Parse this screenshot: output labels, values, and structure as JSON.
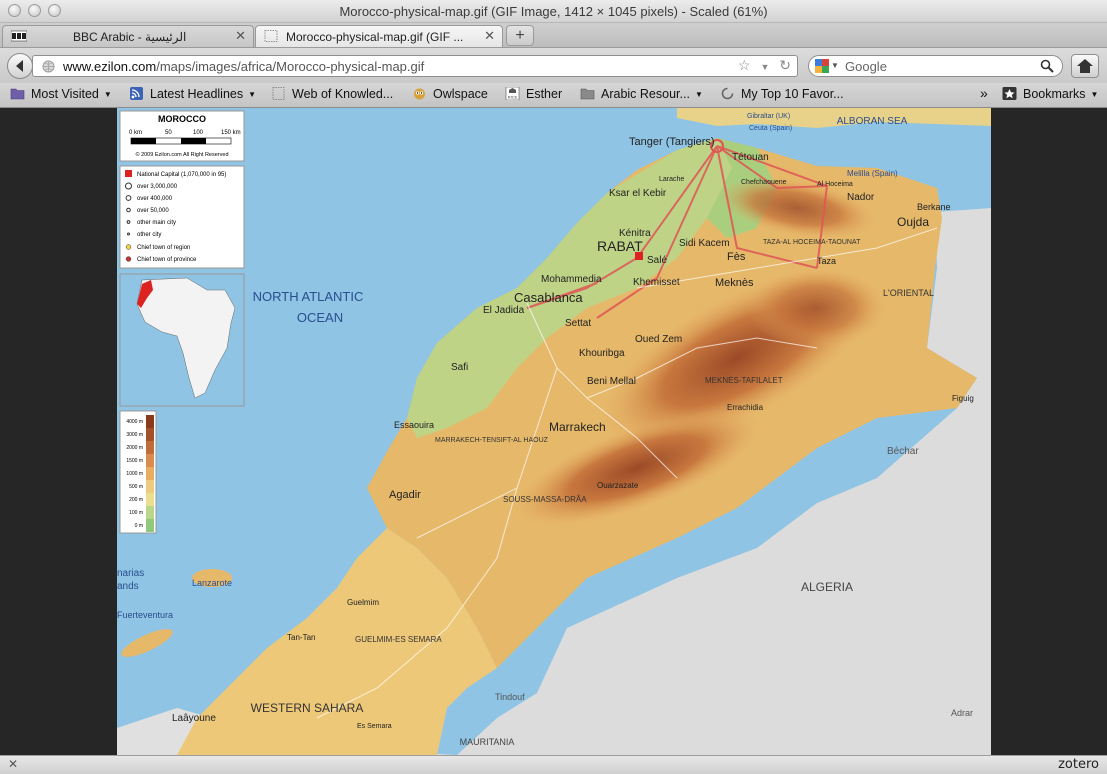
{
  "window": {
    "title": "Morocco-physical-map.gif (GIF Image, 1412 × 1045 pixels) - Scaled (61%)"
  },
  "tabs": [
    {
      "label": "BBC Arabic - الرئيسية",
      "favicon": "bbc-icon",
      "active": false
    },
    {
      "label": "Morocco-physical-map.gif (GIF ...",
      "favicon": "image-icon",
      "active": true
    }
  ],
  "toolbar": {
    "url_domain": "www.ezilon.com",
    "url_path": "/maps/images/africa/Morocco-physical-map.gif",
    "search_placeholder": "Google"
  },
  "bookmarks": [
    {
      "label": "Most Visited",
      "icon": "folder-icon",
      "dropdown": true
    },
    {
      "label": "Latest Headlines",
      "icon": "rss-icon",
      "dropdown": true
    },
    {
      "label": "Web of Knowled...",
      "icon": "page-icon",
      "dropdown": false
    },
    {
      "label": "Owlspace",
      "icon": "owl-icon",
      "dropdown": false
    },
    {
      "label": "Esther",
      "icon": "esther-icon",
      "dropdown": false
    },
    {
      "label": "Arabic Resour...",
      "icon": "folder-icon",
      "dropdown": true
    },
    {
      "label": "My Top 10 Favor...",
      "icon": "loading-icon",
      "dropdown": false
    }
  ],
  "bookmarks_menu": {
    "label": "Bookmarks",
    "chevron": "»"
  },
  "status": {
    "close_glyph": "✕",
    "zotero": "zotero"
  },
  "map": {
    "legend_title": "MOROCCO",
    "scale_ticks": [
      "0 km",
      "50",
      "100",
      "150 km"
    ],
    "copyright": "© 2009 Ezilon.com All Right Reserved",
    "legend_items": [
      "National Capital (1,070,000 in 95)",
      "over 3,000,000",
      "over 400,000",
      "over 50,000",
      "other main city",
      "other city",
      "Chief town of region",
      "Chief town of province"
    ],
    "elevation_labels": [
      "4000 m",
      "3000 m",
      "2000 m",
      "1500 m",
      "1000 m",
      "500 m",
      "200 m",
      "100 m",
      "0 m"
    ],
    "elevation_colors": [
      "#8a3b1c",
      "#a4512a",
      "#c26c3b",
      "#d98c4d",
      "#e8ad63",
      "#efcb80",
      "#e9df8f",
      "#b9d68a",
      "#8fc97b"
    ],
    "ocean_label_1": "NORTH ATLANTIC",
    "ocean_label_2": "OCEAN",
    "sea_label": "ALBORAN SEA",
    "country_algeria": "ALGERIA",
    "western_sahara": "WESTERN SAHARA",
    "mauritania": "MAURITANIA",
    "canarias": "narias",
    "canarias_sub": "ands",
    "lanzarote": "Lanzarote",
    "fuerteventura": "Fuerteventura",
    "cities": {
      "tanger": "Tanger (Tangiers)",
      "tetouan": "Tétouan",
      "ceuta": "Ceuta (Spain)",
      "gibraltar": "Gibraltar (UK)",
      "melilla": "Melilla (Spain)",
      "nador": "Nador",
      "oujda": "Oujda",
      "berkane": "Berkane",
      "ksar": "Ksar el Kebir",
      "kenitra": "Kénitra",
      "rabat": "RABAT",
      "sale": "Salé",
      "sidikacem": "Sidi Kacem",
      "fes": "Fès",
      "meknes": "Meknès",
      "taza": "Taza",
      "mohammedia": "Mohammedia",
      "casablanca": "Casablanca",
      "khemisset": "Khemisset",
      "eljadida": "El Jadida",
      "settat": "Settat",
      "ouedzem": "Oued Zem",
      "khouribga": "Khouribga",
      "safi": "Safi",
      "benimellal": "Beni Mellal",
      "essaouira": "Essaouira",
      "marrakech": "Marrakech",
      "agadir": "Agadir",
      "ouarzazate": "Ouarzazate",
      "guelmim": "Guelmim",
      "tantan": "Tan-Tan",
      "laayoune": "Laâyoune",
      "smara": "Es Semara",
      "bechar": "Béchar",
      "figuig": "Figuig",
      "errachidia": "Errachidia",
      "tindouf": "Tindouf",
      "adrar": "Adrar",
      "oriental": "L'ORIENTAL",
      "guelmim_region": "GUELMIM-ES SEMARA",
      "souss": "SOUSS-MASSA-DRÂA",
      "marrakech_region": "MARRAKECH-TENSIFT-AL HAOUZ",
      "meknes_region": "MEKNÈS-TAFILALET",
      "taza_region": "TAZA-AL HOCEIMA-TAOUNAT",
      "alhoceima": "Al Hoceima",
      "larache": "Larache",
      "chefchaouene": "Chefchaouene"
    }
  }
}
